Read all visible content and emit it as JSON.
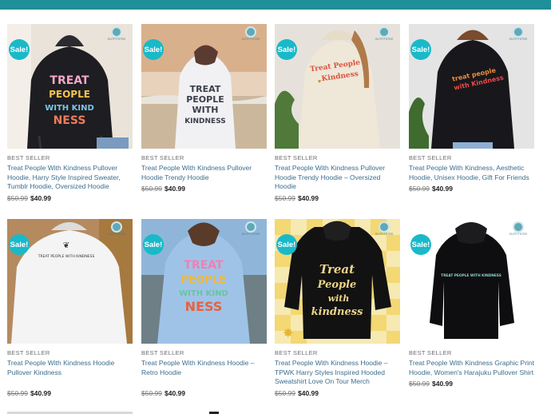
{
  "sale_badge": "Sale!",
  "brand_mark": "OUTFITSTEE",
  "products": [
    {
      "category": "BEST SELLER",
      "title": "Treat People With Kindness Pullover Hoodie, Harry Style Inspired Sweater, Tumblr Hoodie, Oversized Hoodie",
      "old_price": "$50.99",
      "new_price": "$40.99",
      "hoodie_color": "#1d1d22",
      "bg": "#e9e3da"
    },
    {
      "category": "BEST SELLER",
      "title": "Treat People With Kindness Pullover Hoodie Trendy Hoodie",
      "old_price": "$50.99",
      "new_price": "$40.99",
      "hoodie_color": "#f1f1f4",
      "bg": "#c9b9a8"
    },
    {
      "category": "BEST SELLER",
      "title": "Treat People With Kindness Pullover Hoodie Trendy Hoodie – Oversized Hoodie",
      "old_price": "$50.99",
      "new_price": "$40.99",
      "hoodie_color": "#efe7d8",
      "bg": "#e6e2db"
    },
    {
      "category": "BEST SELLER",
      "title": "Treat People With Kindness, Aesthetic Hoodie, Unisex Hoodie, Gift For Friends",
      "old_price": "$50.99",
      "new_price": "$40.99",
      "hoodie_color": "#18181c",
      "bg": "#e4e4e4"
    },
    {
      "category": "BEST SELLER",
      "title": "Treat People With Kindness Hoodie Pullover Kindness",
      "old_price": "$50.99",
      "new_price": "$40.99",
      "hoodie_color": "#f4f4f4",
      "bg": "#b58a5f"
    },
    {
      "category": "BEST SELLER",
      "title": "Treat People With Kindness Hoodie – Retro Hoodie",
      "old_price": "$50.99",
      "new_price": "$40.99",
      "hoodie_color": "#9fc3e7",
      "bg": "#7ea7c8"
    },
    {
      "category": "BEST SELLER",
      "title": "Treat People With Kindness Hoodie – TPWK Harry Styles Inspired Hooded Sweatshirt Love On Tour Merch",
      "old_price": "$50.99",
      "new_price": "$40.99",
      "hoodie_color": "#121212",
      "bg": "#f6e9b2"
    },
    {
      "category": "BEST SELLER",
      "title": "Treat People With Kindness Graphic Print Hoodie, Women's Harajuku Pullover Shirt",
      "old_price": "$50.99",
      "new_price": "$40.99",
      "hoodie_color": "#0e0e10",
      "bg": "#ffffff"
    }
  ]
}
